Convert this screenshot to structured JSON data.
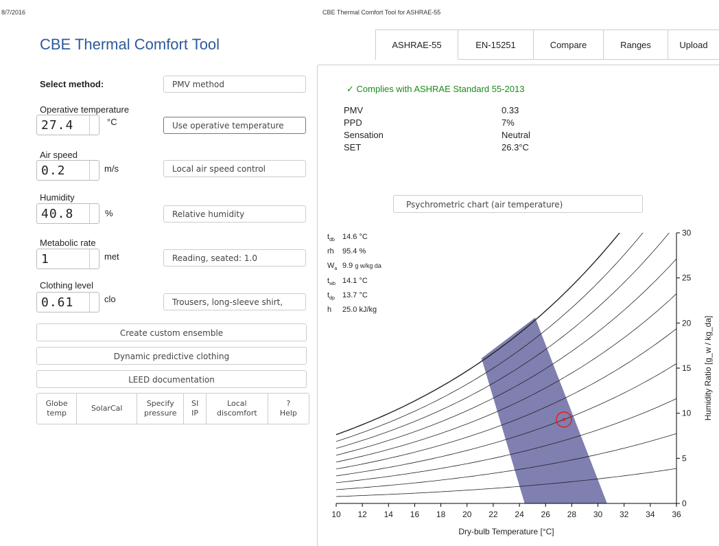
{
  "header": {
    "date": "8/7/2016",
    "page_title": "CBE Thermal Comfort Tool for ASHRAE-55"
  },
  "app": {
    "title": "CBE Thermal Comfort Tool"
  },
  "tabs": [
    "ASHRAE-55",
    "EN-15251",
    "Compare",
    "Ranges",
    "Upload"
  ],
  "form": {
    "method_label": "Select method:",
    "method_value": "PMV method",
    "inputs": [
      {
        "label": "Operative temperature",
        "value": "27.4",
        "unit": "°C",
        "option": "Use operative temperature"
      },
      {
        "label": "Air speed",
        "value": "0.2",
        "unit": "m/s",
        "option": "Local air speed control"
      },
      {
        "label": "Humidity",
        "value": "40.8",
        "unit": "%",
        "option": "Relative humidity"
      },
      {
        "label": "Metabolic rate",
        "value": "1",
        "unit": "met",
        "option": "Reading, seated: 1.0"
      },
      {
        "label": "Clothing level",
        "value": "0.61",
        "unit": "clo",
        "option": "Trousers, long-sleeve shirt,"
      }
    ],
    "buttons": [
      "Create custom ensemble",
      "Dynamic predictive clothing",
      "LEED documentation"
    ],
    "tools": [
      "Globe\ntemp",
      "SolarCal",
      "Specify\npressure",
      "SI\nIP",
      "Local\ndiscomfort",
      "?\nHelp"
    ]
  },
  "results": {
    "compliance": "✓  Complies with ASHRAE Standard 55-2013",
    "rows": [
      {
        "name": "PMV",
        "value": "0.33"
      },
      {
        "name": "PPD",
        "value": "7%"
      },
      {
        "name": "Sensation",
        "value": "Neutral"
      },
      {
        "name": "SET",
        "value": "26.3°C"
      }
    ]
  },
  "chart_selector": "Psychrometric chart (air temperature)",
  "readout": [
    {
      "sym": "t",
      "sub": "db",
      "val": "14.6",
      "unit": "°C"
    },
    {
      "sym": "rh",
      "sub": "",
      "val": "95.4",
      "unit": "%"
    },
    {
      "sym": "W",
      "sub": "a",
      "val": "9.9",
      "unit": "g w/kg da"
    },
    {
      "sym": "t",
      "sub": "wb",
      "val": "14.1",
      "unit": "°C"
    },
    {
      "sym": "t",
      "sub": "dp",
      "val": "13.7",
      "unit": "°C"
    },
    {
      "sym": "h",
      "sub": "",
      "val": "25.0",
      "unit": "kJ/kg"
    }
  ],
  "chart_data": {
    "type": "line",
    "xlabel": "Dry-bulb Temperature [°C]",
    "ylabel": "Humidity Ratio [g_w / kg_da]",
    "xlim": [
      10,
      36
    ],
    "ylim": [
      0,
      30
    ],
    "xticks": [
      10,
      12,
      14,
      16,
      18,
      20,
      22,
      24,
      26,
      28,
      30,
      32,
      34,
      36
    ],
    "yticks": [
      0,
      5,
      10,
      15,
      20,
      25,
      30
    ],
    "rh_curves": [
      0.1,
      0.2,
      0.3,
      0.4,
      0.5,
      0.6,
      0.7,
      0.8,
      0.9,
      1.0
    ],
    "comfort_zone": [
      [
        24.4,
        0
      ],
      [
        30.7,
        0
      ],
      [
        25.2,
        20.6
      ],
      [
        21.1,
        16.1
      ]
    ],
    "point": {
      "x": 27.4,
      "y": 9.3
    },
    "colors": {
      "zone": "#7f7fb0",
      "point": "#e02020",
      "curve": "#222222"
    }
  }
}
